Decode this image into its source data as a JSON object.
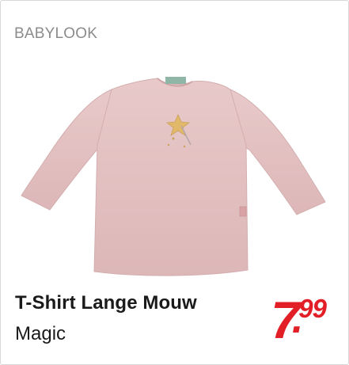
{
  "brand": "BABYLOOK",
  "product": {
    "title": "T-Shirt Lange Mouw",
    "subtitle": "Magic",
    "image_icon": "pink-long-sleeve-shirt-icon"
  },
  "price": {
    "integer": "7",
    "decimal": "99"
  },
  "colors": {
    "price": "#e21f26",
    "brand": "#8b8b8b",
    "shirt": "#e5c3c4"
  }
}
